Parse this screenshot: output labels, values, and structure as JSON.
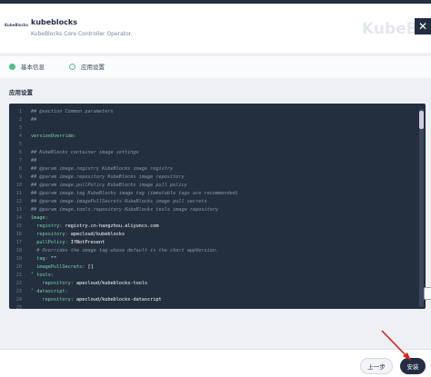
{
  "header": {
    "logo_text": "KubeBlocks",
    "title": "kubeblocks",
    "description": "KubeBlocks Core Controller Operator.",
    "watermark": "KubeBlocks",
    "close_icon": "close-icon"
  },
  "steps": [
    {
      "label": "基本信息",
      "state": "completed",
      "color": "#55bc8a"
    },
    {
      "label": "应用设置",
      "state": "current",
      "color": "#55bc8a"
    }
  ],
  "section_title": "应用设置",
  "editor": {
    "lines": [
      {
        "num": "1",
        "fold": "",
        "segments": [
          {
            "cls": "comment",
            "text": "## @section Common parameters"
          }
        ]
      },
      {
        "num": "2",
        "fold": "",
        "segments": [
          {
            "cls": "comment",
            "text": "##"
          }
        ]
      },
      {
        "num": "3",
        "fold": "",
        "segments": []
      },
      {
        "num": "4",
        "fold": "",
        "segments": [
          {
            "cls": "key",
            "text": "versionOverride:"
          }
        ]
      },
      {
        "num": "5",
        "fold": "",
        "segments": []
      },
      {
        "num": "6",
        "fold": "",
        "segments": [
          {
            "cls": "comment",
            "text": "## KubeBlocks container image settings"
          }
        ]
      },
      {
        "num": "7",
        "fold": "",
        "segments": [
          {
            "cls": "comment",
            "text": "##"
          }
        ]
      },
      {
        "num": "8",
        "fold": "",
        "segments": [
          {
            "cls": "comment",
            "text": "## @param image.registry KubeBlocks image registry"
          }
        ]
      },
      {
        "num": "9",
        "fold": "",
        "segments": [
          {
            "cls": "comment",
            "text": "## @param image.repository KubeBlocks image repository"
          }
        ]
      },
      {
        "num": "10",
        "fold": "",
        "segments": [
          {
            "cls": "comment",
            "text": "## @param image.pullPolicy KubeBlocks image pull policy"
          }
        ]
      },
      {
        "num": "11",
        "fold": "",
        "segments": [
          {
            "cls": "comment",
            "text": "## @param image.tag KubeBlocks image tag (immutable tags are recommended)"
          }
        ]
      },
      {
        "num": "12",
        "fold": "",
        "segments": [
          {
            "cls": "comment",
            "text": "## @param image.imagePullSecrets KubeBlocks image pull secrets"
          }
        ]
      },
      {
        "num": "13",
        "fold": "",
        "segments": [
          {
            "cls": "comment",
            "text": "## @param image.tools.repository KubeBlocks tools image repository"
          }
        ]
      },
      {
        "num": "14",
        "fold": "▾",
        "segments": [
          {
            "cls": "key",
            "text": "image:"
          }
        ]
      },
      {
        "num": "15",
        "fold": "",
        "segments": [
          {
            "cls": "key",
            "text": "  registry: "
          },
          {
            "cls": "val",
            "text": "registry.cn-hangzhou.aliyuncs.com"
          }
        ]
      },
      {
        "num": "16",
        "fold": "",
        "segments": [
          {
            "cls": "key",
            "text": "  repository: "
          },
          {
            "cls": "val",
            "text": "apecloud/kubeblocks"
          }
        ]
      },
      {
        "num": "17",
        "fold": "",
        "segments": [
          {
            "cls": "key",
            "text": "  pullPolicy: "
          },
          {
            "cls": "val",
            "text": "IfNotPresent"
          }
        ]
      },
      {
        "num": "18",
        "fold": "",
        "segments": [
          {
            "cls": "comment",
            "text": "  # Overrides the image tag whose default is the chart appVersion."
          }
        ]
      },
      {
        "num": "19",
        "fold": "",
        "segments": [
          {
            "cls": "key",
            "text": "  tag: "
          },
          {
            "cls": "val",
            "text": "\"\""
          }
        ]
      },
      {
        "num": "20",
        "fold": "",
        "segments": [
          {
            "cls": "key",
            "text": "  imagePullSecrets: "
          },
          {
            "cls": "val",
            "text": "[]"
          }
        ]
      },
      {
        "num": "21",
        "fold": "▾",
        "segments": [
          {
            "cls": "key",
            "text": "  tools:"
          }
        ]
      },
      {
        "num": "22",
        "fold": "",
        "segments": [
          {
            "cls": "key",
            "text": "    repository: "
          },
          {
            "cls": "val",
            "text": "apecloud/kubeblocks-tools"
          }
        ]
      },
      {
        "num": "23",
        "fold": "▾",
        "segments": [
          {
            "cls": "key",
            "text": "  datascript:"
          }
        ]
      },
      {
        "num": "24",
        "fold": "",
        "segments": [
          {
            "cls": "key",
            "text": "    repository: "
          },
          {
            "cls": "val",
            "text": "apecloud/kubeblocks-datascript"
          }
        ]
      },
      {
        "num": "25",
        "fold": "",
        "segments": []
      }
    ]
  },
  "footer": {
    "prev_label": "上一步",
    "install_label": "安装"
  },
  "colors": {
    "accent": "#55bc8a",
    "dark": "#242e42",
    "editor_bg": "#232e3f",
    "arrow": "#e02020"
  }
}
